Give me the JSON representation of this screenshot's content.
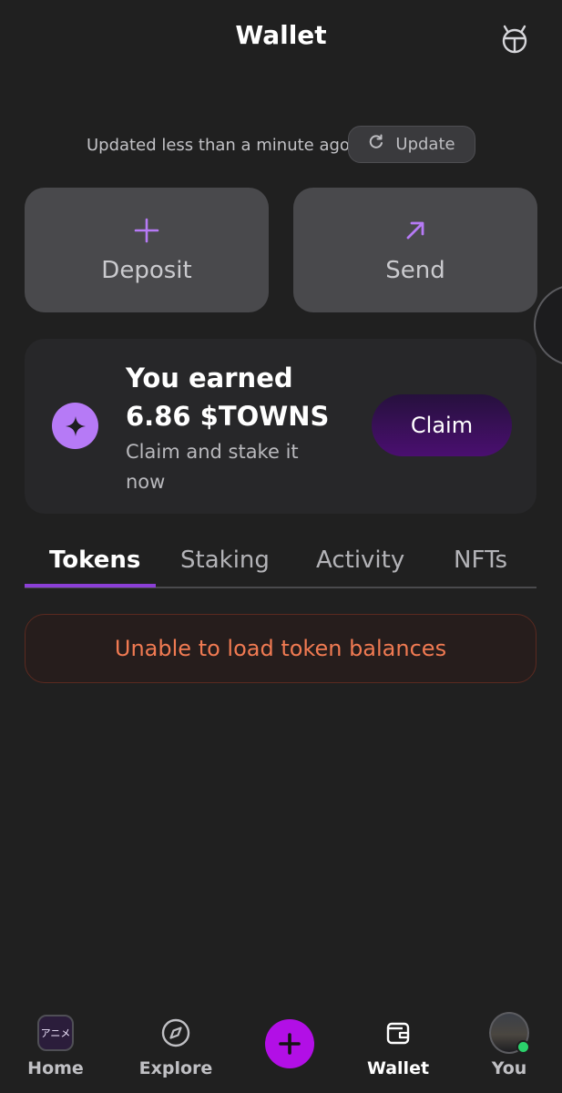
{
  "header": {
    "title": "Wallet",
    "icon": "helmet-icon"
  },
  "update": {
    "status_text": "Updated less than a minute ago",
    "button_label": "Update",
    "icon": "refresh-icon"
  },
  "actions": {
    "deposit": {
      "label": "Deposit",
      "icon": "plus-icon"
    },
    "send": {
      "label": "Send",
      "icon": "arrow-up-right-icon"
    }
  },
  "earnings": {
    "title": "You earned",
    "amount": "6.86 $TOWNS",
    "subtitle": "Claim and stake it now",
    "claim_label": "Claim",
    "icon": "towns-star-icon"
  },
  "tabs": [
    {
      "label": "Tokens",
      "active": true
    },
    {
      "label": "Staking",
      "active": false
    },
    {
      "label": "Activity",
      "active": false
    },
    {
      "label": "NFTs",
      "active": false
    }
  ],
  "error": {
    "message": "Unable to load token balances"
  },
  "bottom_nav": {
    "home": {
      "label": "Home",
      "tile_text": "アニメ"
    },
    "explore": {
      "label": "Explore",
      "icon": "compass-icon"
    },
    "create": {
      "icon": "plus-icon"
    },
    "wallet": {
      "label": "Wallet",
      "icon": "wallet-icon",
      "active": true
    },
    "you": {
      "label": "You",
      "icon": "avatar"
    }
  },
  "colors": {
    "background": "#202020",
    "accent_purple": "#b67af6",
    "fab": "#b20fe6",
    "error": "#f07a52",
    "online": "#2bd16b"
  }
}
